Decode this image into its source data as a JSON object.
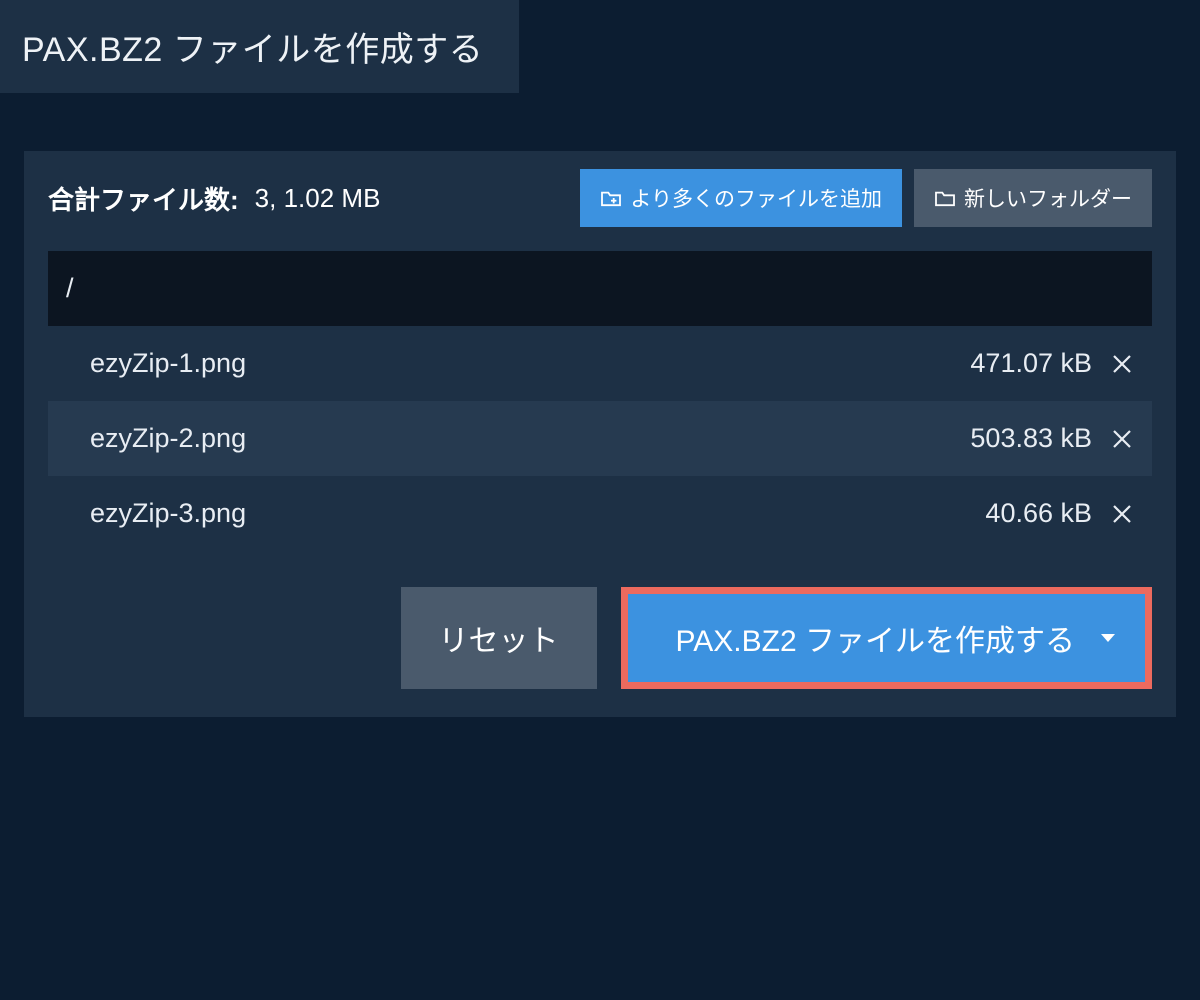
{
  "header": {
    "title": "PAX.BZ2 ファイルを作成する"
  },
  "toolbar": {
    "total_label": "合計ファイル数:",
    "total_value": "3, 1.02 MB",
    "add_files_label": "より多くのファイルを追加",
    "new_folder_label": "新しいフォルダー"
  },
  "path": "/",
  "files": [
    {
      "name": "ezyZip-1.png",
      "size": "471.07 kB"
    },
    {
      "name": "ezyZip-2.png",
      "size": "503.83 kB"
    },
    {
      "name": "ezyZip-3.png",
      "size": "40.66 kB"
    }
  ],
  "footer": {
    "reset_label": "リセット",
    "create_label": "PAX.BZ2 ファイルを作成する"
  }
}
